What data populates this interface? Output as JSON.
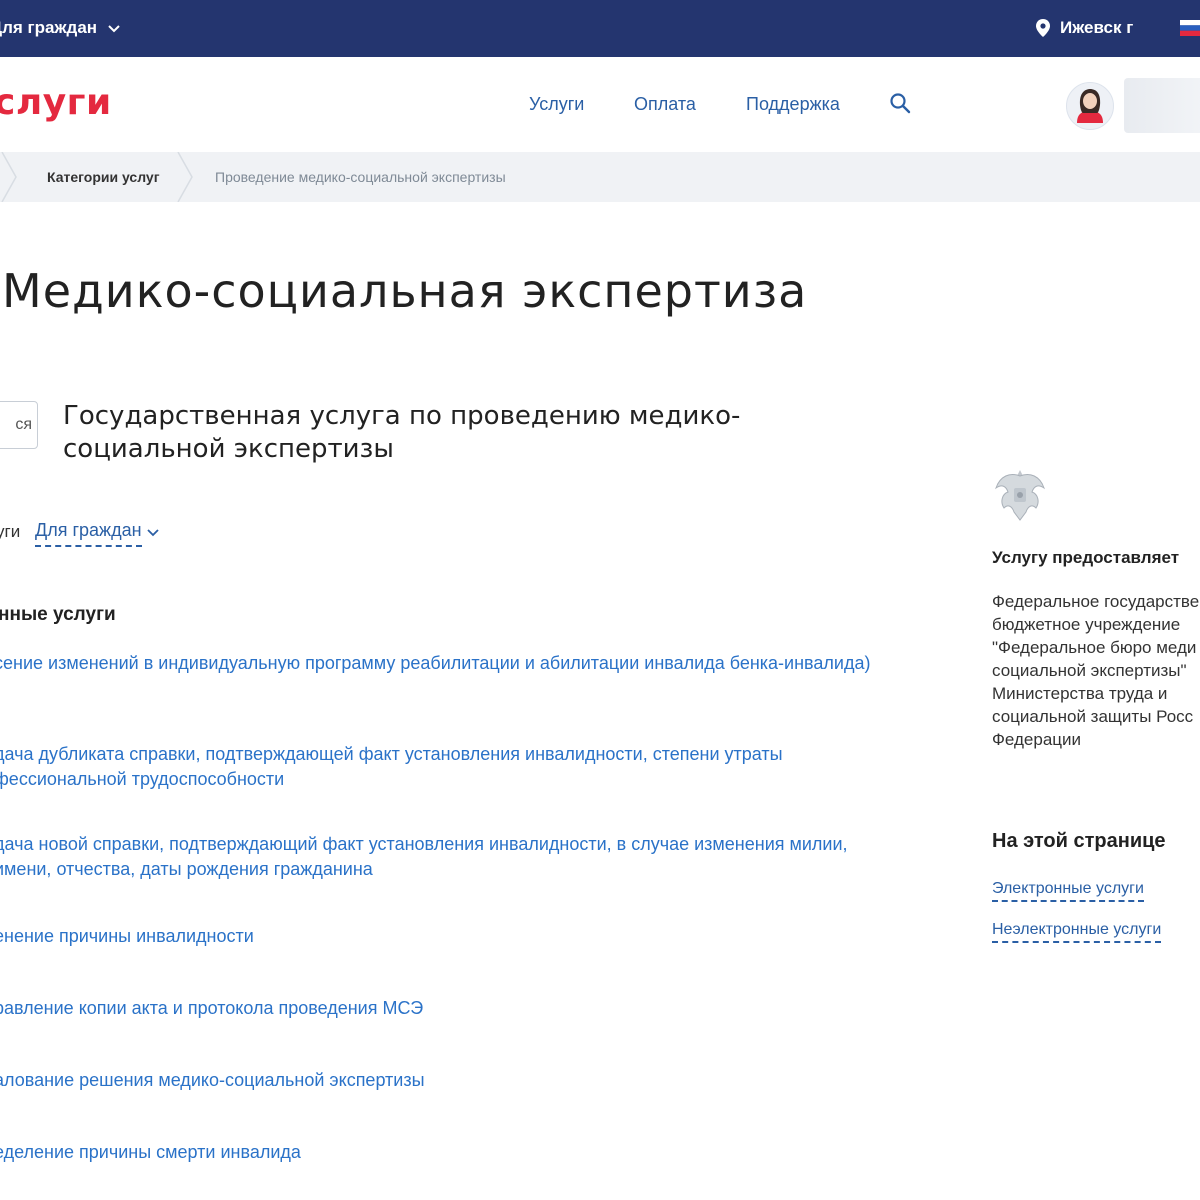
{
  "topbar": {
    "audience_label": "Для граждан",
    "city": "Ижевск г",
    "colors": {
      "bg": "#24356f"
    }
  },
  "header": {
    "logo_text": "слуги",
    "nav": [
      "Услуги",
      "Оплата",
      "Поддержка"
    ],
    "search_icon": "search-icon",
    "avatar_icon": "user-avatar-icon"
  },
  "breadcrumbs": [
    "Категории услуг",
    "Проведение медико-социальной экспертизы"
  ],
  "page": {
    "title": "Медико-социальная экспертиза",
    "left_button": "ся",
    "subtitle": "Государственная услуга по проведению медико-социальной экспертизы",
    "filter_label": "уги",
    "filter_value": "Для граждан",
    "section_title": "нные услуги",
    "services": [
      "сение изменений в индивидуальную программу реабилитации и абилитации инвалида бенка-инвалида)",
      "дача дубликата справки, подтверждающей факт установления инвалидности, степени утраты фессиональной трудоспособности",
      "дача новой справки, подтверждающий факт установления инвалидности, в случае изменения милии, имени, отчества, даты рождения гражданина",
      "енение причины инвалидности",
      "равление копии акта и протокола проведения МСЭ",
      "алование решения медико-социальной экспертизы",
      "еделение причины смерти инвалида"
    ]
  },
  "sidebar": {
    "emblem_icon": "russian-emblem-icon",
    "provider_heading": "Услугу предоставляет",
    "provider_text": "Федеральное государстве бюджетное учреждение \"Федеральное бюро меди социальной экспертизы\" Министерства труда и социальной защиты Росс Федерации",
    "on_page_heading": "На этой странице",
    "anchors": [
      "Электронные услуги",
      "Неэлектронные услуги"
    ]
  },
  "colors": {
    "accent": "#2a72c8",
    "logo": "#e4293f",
    "crumb_bg": "#f0f2f5"
  }
}
